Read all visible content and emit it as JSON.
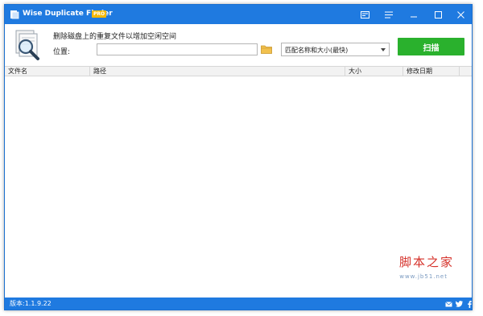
{
  "window": {
    "title": "Wise Duplicate Finder",
    "badge": "PRO",
    "controls": {
      "skin_icon": "skin-icon",
      "menu_icon": "menu-icon",
      "minimize_icon": "minimize-icon",
      "maximize_icon": "maximize-icon",
      "close_icon": "close-icon"
    }
  },
  "toolbar": {
    "tagline": "删除磁盘上的重复文件以增加空闲空间",
    "location_label": "位置:",
    "location_value": "",
    "match_mode": "匹配名称和大小(最快)",
    "scan_label": "扫描"
  },
  "table": {
    "columns": [
      "文件名",
      "路径",
      "大小",
      "修改日期"
    ],
    "rows": []
  },
  "watermark": {
    "text": "脚本之家",
    "url": "www.jb51.net"
  },
  "statusbar": {
    "version": "版本:1.1.9.22"
  },
  "colors": {
    "accent": "#1f7ae0",
    "scan_button": "#2ab12d",
    "badge": "#f5b800"
  }
}
